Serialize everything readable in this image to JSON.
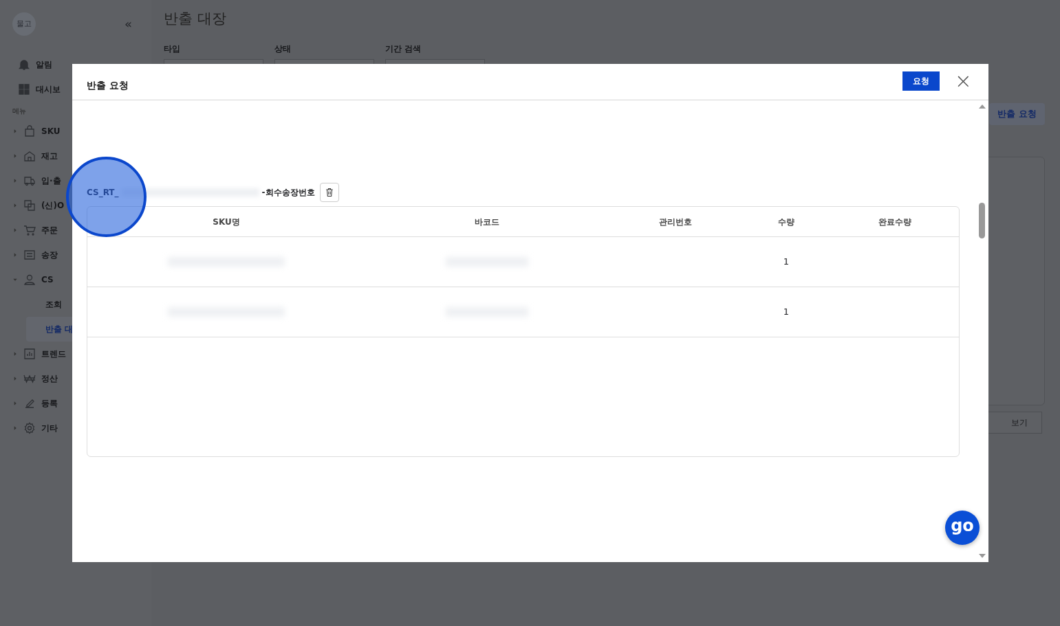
{
  "sidebar": {
    "avatar": "물고",
    "collapse": "«",
    "top_links": [
      {
        "label": "알림"
      },
      {
        "label": "대시보"
      }
    ],
    "section": "메뉴",
    "menu": [
      {
        "label": "SKU",
        "expanded": false
      },
      {
        "label": "재고",
        "expanded": false
      },
      {
        "label": "입·출",
        "expanded": false
      },
      {
        "label": "(신)O",
        "expanded": false
      },
      {
        "label": "주문",
        "expanded": false
      },
      {
        "label": "송장",
        "expanded": false
      },
      {
        "label": "CS",
        "expanded": true,
        "children": [
          {
            "label": "조회",
            "selected": false
          },
          {
            "label": "반출 대",
            "selected": true
          }
        ]
      },
      {
        "label": "트렌드",
        "expanded": false
      },
      {
        "label": "정산",
        "expanded": false
      },
      {
        "label": "등록",
        "expanded": false
      },
      {
        "label": "기타",
        "expanded": false
      }
    ]
  },
  "page": {
    "title": "반출 대장",
    "filters": [
      {
        "label": "타입"
      },
      {
        "label": "상태"
      },
      {
        "label": "기간 검색"
      }
    ],
    "request_button": "반출 요청",
    "view_button": "보기"
  },
  "modal": {
    "title": "반출 요청",
    "submit": "요청",
    "close": "×",
    "group": {
      "prefix": "CS_RT_",
      "suffix": "-회수송장번호"
    },
    "table": {
      "columns": [
        "SKU명",
        "바코드",
        "관리번호",
        "수량",
        "완료수량"
      ],
      "rows": [
        {
          "qty": "1"
        },
        {
          "qty": "1"
        }
      ]
    }
  },
  "chat_button": "go"
}
